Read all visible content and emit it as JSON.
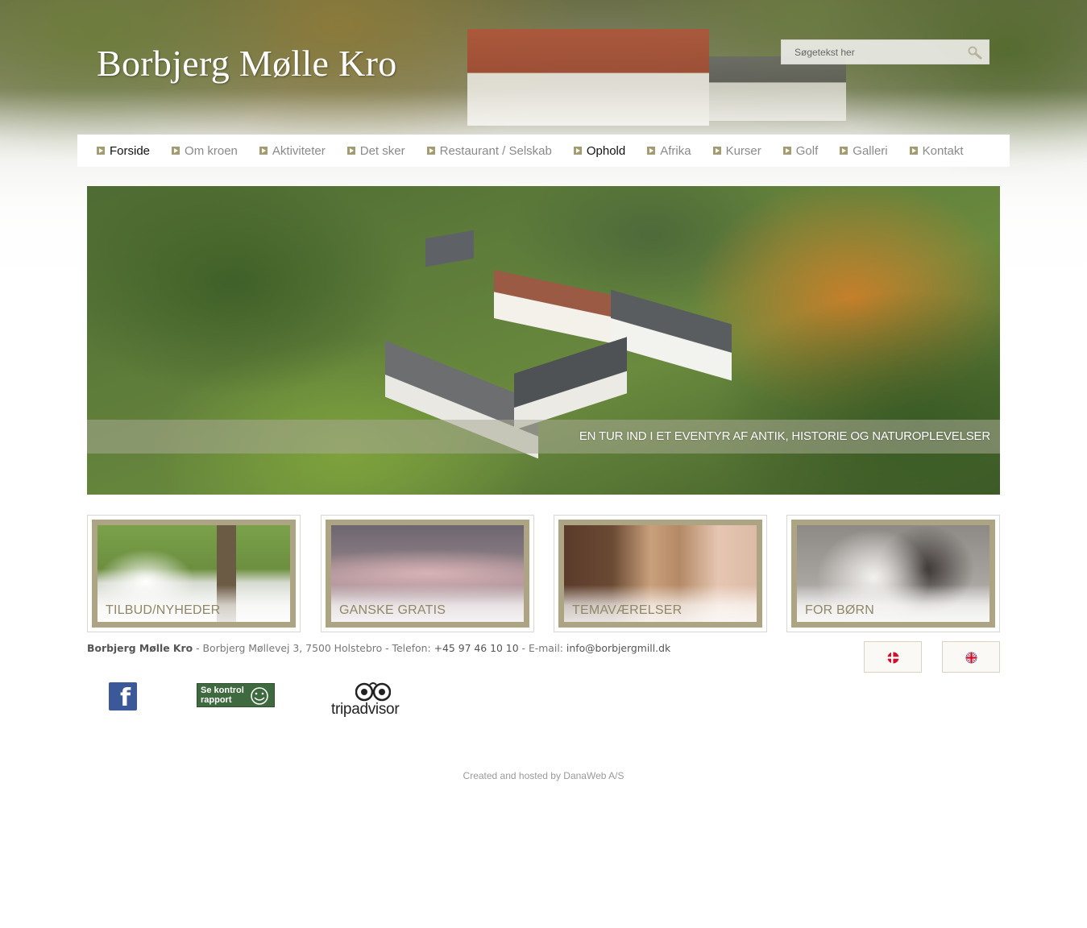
{
  "site": {
    "logo_text": "Borbjerg Mølle Kro"
  },
  "search": {
    "placeholder": "Søgetekst her",
    "button_icon": "search-icon"
  },
  "nav": {
    "items": [
      {
        "label": "Forside",
        "active": true
      },
      {
        "label": "Om kroen",
        "active": false
      },
      {
        "label": "Aktiviteter",
        "active": false
      },
      {
        "label": "Det sker",
        "active": false
      },
      {
        "label": "Restaurant / Selskab",
        "active": false
      },
      {
        "label": "Ophold",
        "active": true
      },
      {
        "label": "Afrika",
        "active": false
      },
      {
        "label": "Kurser",
        "active": false
      },
      {
        "label": "Golf",
        "active": false
      },
      {
        "label": "Galleri",
        "active": false
      },
      {
        "label": "Kontakt",
        "active": false
      }
    ]
  },
  "hero": {
    "caption": "EN TUR IND I ET EVENTYR AF ANTIK, HISTORIE OG NATUROPLEVELSER"
  },
  "tiles": [
    {
      "label": "TILBUD/NYHEDER"
    },
    {
      "label": "GANSKE GRATIS"
    },
    {
      "label": "TEMAVÆRELSER"
    },
    {
      "label": "FOR BØRN"
    }
  ],
  "contact": {
    "name": "Borbjerg Mølle Kro",
    "address": " - Borbjerg Møllevej 3, 7500 Holstebro - Telefon: ",
    "phone": "+45 97 46 10 10",
    "email_label": " - E-mail: ",
    "email": "info@borbjergmill.dk"
  },
  "languages": [
    {
      "name": "Dansk",
      "icon": "danish-flag-icon"
    },
    {
      "name": "English",
      "icon": "uk-flag-icon"
    }
  ],
  "badges": {
    "facebook_glyph": "f",
    "kontrol_text": "Se kontrol rapport",
    "tripadvisor_text": "tripadvisor"
  },
  "colors": {
    "nav_bullet": "#a39c72",
    "tile_frame": "#ada483",
    "tile_label": "#8f8766",
    "facebook": "#3b5998"
  },
  "footer": {
    "credit": "Created and hosted by DanaWeb A/S"
  }
}
